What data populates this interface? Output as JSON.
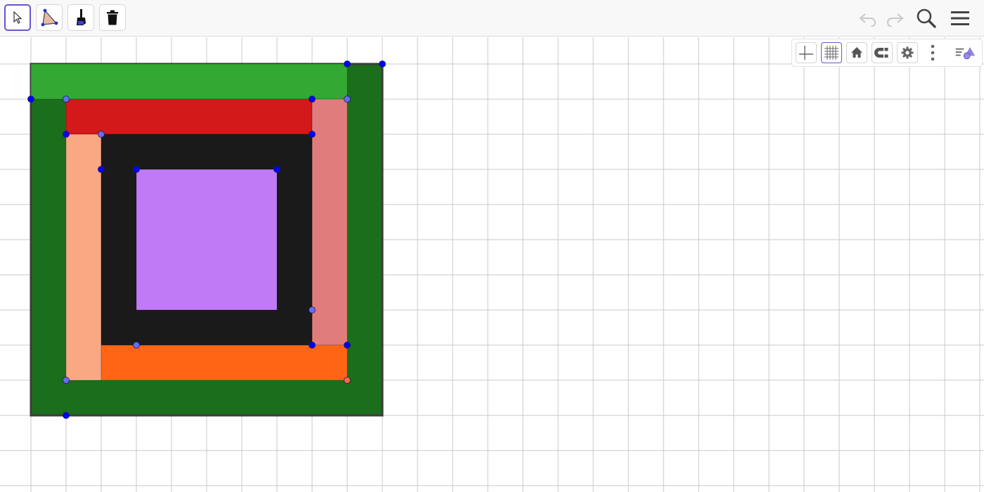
{
  "app": {
    "toolbar": {
      "tools": [
        {
          "name": "move-tool",
          "icon": "arrow-cursor-icon",
          "selected": true
        },
        {
          "name": "polygon-tool",
          "icon": "polygon-icon",
          "selected": false
        },
        {
          "name": "style-brush-tool",
          "icon": "paint-brush-icon",
          "selected": false
        },
        {
          "name": "delete-tool",
          "icon": "trash-icon",
          "selected": false
        }
      ],
      "right": [
        "undo-icon",
        "redo-icon",
        "search-icon",
        "hamburger-menu-icon"
      ],
      "undo_enabled": false,
      "redo_enabled": false
    },
    "style_bar": {
      "buttons": [
        "show-axes-icon",
        "show-grid-icon",
        "home-icon",
        "point-capturing-icon",
        "settings-gear-icon",
        "more-options-icon",
        "toggle-style-bar-icon"
      ],
      "grid_active": true
    }
  },
  "colors": {
    "accent": "#6557d2",
    "grid": "#c8c8c8",
    "outer_square": "#1b6e1b",
    "outer_border": "#3c3c3c",
    "top_strip": "#33a833",
    "red_strip": "#d31919",
    "light_red_strip": "#e17c7c",
    "peach_strip": "#faa884",
    "orange_strip": "#ff6515",
    "black_frame": "#1a1a1a",
    "purple_square": "#c07af6",
    "point_blue": "#0000ff",
    "point_light": "#6b6bef",
    "point_orange": "#ff6a3c"
  },
  "construction": {
    "polygons": [
      {
        "name": "outer-dark-green-square",
        "color": "outer_square",
        "vertices": [
          [
            0,
            0
          ],
          [
            10,
            0
          ],
          [
            10,
            10
          ],
          [
            0,
            10
          ]
        ],
        "border": true
      },
      {
        "name": "top-green-strip",
        "color": "top_strip",
        "vertices": [
          [
            0,
            0
          ],
          [
            9,
            0
          ],
          [
            9,
            1
          ],
          [
            0,
            1
          ]
        ]
      },
      {
        "name": "red-strip",
        "color": "red_strip",
        "vertices": [
          [
            1,
            1
          ],
          [
            8,
            1
          ],
          [
            8,
            2
          ],
          [
            1,
            2
          ]
        ]
      },
      {
        "name": "light-red-strip",
        "color": "light_red_strip",
        "vertices": [
          [
            8,
            1
          ],
          [
            9,
            1
          ],
          [
            9,
            8
          ],
          [
            8,
            8
          ]
        ]
      },
      {
        "name": "peach-strip",
        "color": "peach_strip",
        "vertices": [
          [
            1,
            2
          ],
          [
            2,
            2
          ],
          [
            2,
            9
          ],
          [
            1,
            9
          ]
        ]
      },
      {
        "name": "orange-strip",
        "color": "orange_strip",
        "vertices": [
          [
            2,
            8
          ],
          [
            9,
            8
          ],
          [
            9,
            9
          ],
          [
            2,
            9
          ]
        ]
      },
      {
        "name": "black-frame",
        "color": "black_frame",
        "vertices": [
          [
            2,
            2
          ],
          [
            8,
            2
          ],
          [
            8,
            8
          ],
          [
            2,
            8
          ]
        ]
      },
      {
        "name": "purple-center-square",
        "color": "purple_square",
        "vertices": [
          [
            3,
            3
          ],
          [
            7,
            3
          ],
          [
            7,
            7
          ],
          [
            3,
            7
          ]
        ]
      }
    ],
    "points": [
      {
        "pos": [
          9,
          0
        ],
        "color": "point_blue"
      },
      {
        "pos": [
          10,
          0
        ],
        "color": "point_blue"
      },
      {
        "pos": [
          0,
          1
        ],
        "color": "point_blue"
      },
      {
        "pos": [
          1,
          1
        ],
        "color": "point_light"
      },
      {
        "pos": [
          8,
          1
        ],
        "color": "point_blue"
      },
      {
        "pos": [
          9,
          1
        ],
        "color": "point_light"
      },
      {
        "pos": [
          1,
          2
        ],
        "color": "point_blue"
      },
      {
        "pos": [
          2,
          2
        ],
        "color": "point_light"
      },
      {
        "pos": [
          8,
          2
        ],
        "color": "point_blue"
      },
      {
        "pos": [
          2,
          3
        ],
        "color": "point_blue"
      },
      {
        "pos": [
          3,
          3
        ],
        "color": "point_blue"
      },
      {
        "pos": [
          7,
          3
        ],
        "color": "point_blue"
      },
      {
        "pos": [
          8,
          7
        ],
        "color": "point_light"
      },
      {
        "pos": [
          3,
          8
        ],
        "color": "point_light"
      },
      {
        "pos": [
          8,
          8
        ],
        "color": "point_blue"
      },
      {
        "pos": [
          9,
          8
        ],
        "color": "point_blue"
      },
      {
        "pos": [
          1,
          9
        ],
        "color": "point_light"
      },
      {
        "pos": [
          9,
          9
        ],
        "color": "point_orange"
      },
      {
        "pos": [
          1,
          10
        ],
        "color": "point_blue"
      }
    ]
  }
}
